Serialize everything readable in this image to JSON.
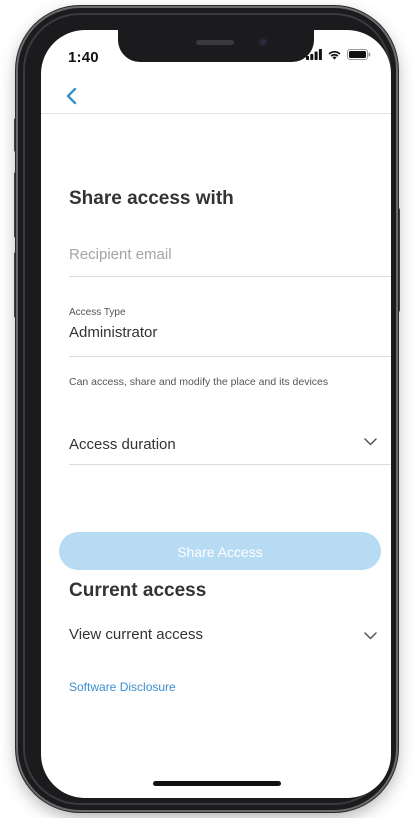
{
  "status_bar": {
    "time": "1:40",
    "icons": [
      "cellular-signal-icon",
      "wifi-icon",
      "battery-icon"
    ]
  },
  "nav": {
    "back_icon": "chevron-left-icon"
  },
  "share_section": {
    "title": "Share access with",
    "email_placeholder": "Recipient email",
    "access_type_label": "Access Type",
    "access_type_value": "Administrator",
    "access_type_description": "Can access, share and modify the place and its devices",
    "duration_label": "Access duration",
    "share_button_label": "Share Access"
  },
  "current_section": {
    "title": "Current access",
    "view_label": "View current access",
    "disclosure_link": "Software Disclosure"
  },
  "colors": {
    "accent": "#3a8fd0",
    "button_disabled": "#b6dbf3",
    "title_text": "#333333",
    "divider": "#dcdcdc"
  }
}
